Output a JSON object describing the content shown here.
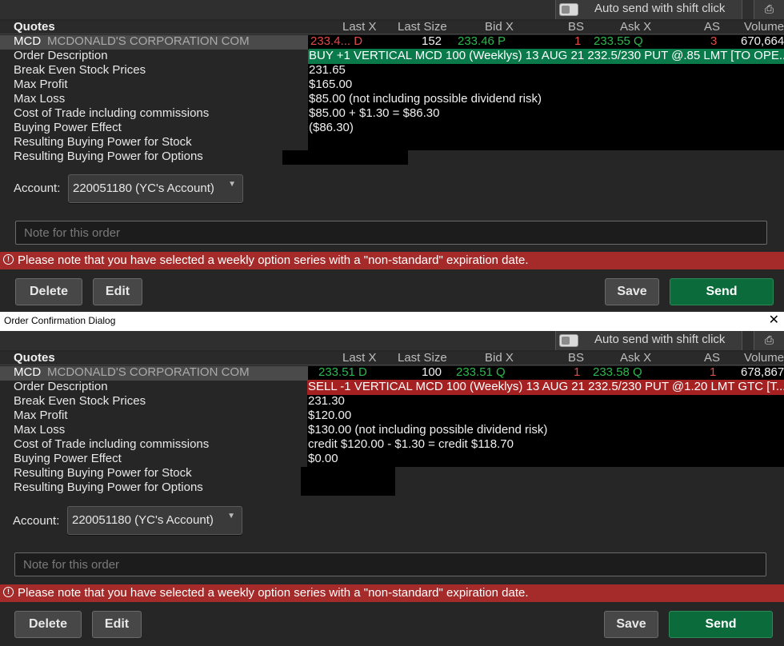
{
  "window_title": "Order Confirmation Dialog",
  "auto_send_label": "Auto send with shift click",
  "columns": {
    "quotes": "Quotes",
    "last_x": "Last X",
    "last_size": "Last Size",
    "bid_x": "Bid X",
    "bs": "BS",
    "ask_x": "Ask X",
    "as": "AS",
    "volume": "Volume"
  },
  "labels": {
    "order_description": "Order Description",
    "break_even": "Break Even Stock Prices",
    "max_profit": "Max Profit",
    "max_loss": "Max Loss",
    "cost_of_trade": "Cost of Trade including commissions",
    "buying_power_effect": "Buying Power Effect",
    "rbp_stock": "Resulting Buying Power for Stock",
    "rbp_options": "Resulting Buying Power for Options",
    "account": "Account:"
  },
  "note_placeholder": "Note for this order",
  "warning_text": "Please note that you have selected a weekly option series with a \"non-standard\" expiration date.",
  "buttons": {
    "delete": "Delete",
    "edit": "Edit",
    "save": "Save",
    "send": "Send"
  },
  "orders": [
    {
      "quote": {
        "symbol": "MCD",
        "description": "MCDONALD'S CORPORATION COM",
        "last_x": "233.4... D",
        "last_size": "152",
        "bid_x": "233.46 P",
        "bs": "1",
        "ask_x": "233.55 Q",
        "as": "3",
        "volume": "670,664"
      },
      "order_description": "BUY +1 VERTICAL MCD 100 (Weeklys) 13 AUG 21 232.5/230 PUT @.85 LMT [TO OPE...",
      "break_even": "231.65",
      "max_profit": "$165.00",
      "max_loss": "$85.00 (not including possible dividend risk)",
      "cost_of_trade": "$85.00 + $1.30 = $86.30",
      "buying_power_effect": "($86.30)",
      "rbp_stock": "",
      "rbp_options": "",
      "account": "220051180 (YC's Account)"
    },
    {
      "quote": {
        "symbol": "MCD",
        "description": "MCDONALD'S CORPORATION COM",
        "last_x": "233.51 D",
        "last_size": "100",
        "bid_x": "233.51 Q",
        "bs": "1",
        "ask_x": "233.58 Q",
        "as": "1",
        "volume": "678,867"
      },
      "order_description": "SELL -1 VERTICAL MCD 100 (Weeklys) 13 AUG 21 232.5/230 PUT @1.20 LMT GTC [T...",
      "break_even": "231.30",
      "max_profit": "$120.00",
      "max_loss": "$130.00 (not including possible dividend risk)",
      "cost_of_trade": "credit $120.00 - $1.30 = credit $118.70",
      "buying_power_effect": "$0.00",
      "rbp_stock": "",
      "rbp_options": "",
      "account": "220051180 (YC's Account)"
    }
  ],
  "colors": {
    "buy_bg": "#0a7a4a",
    "sell_bg": "#a52121",
    "warning_bg": "#a52a2a",
    "send_bg": "#0c6b3a",
    "down_red": "#e34a4a",
    "up_green": "#2cb84e"
  },
  "icons": {
    "print": "printer-icon",
    "close": "close-icon",
    "warning": "info-circle-icon",
    "dropdown": "chevron-down-icon"
  }
}
